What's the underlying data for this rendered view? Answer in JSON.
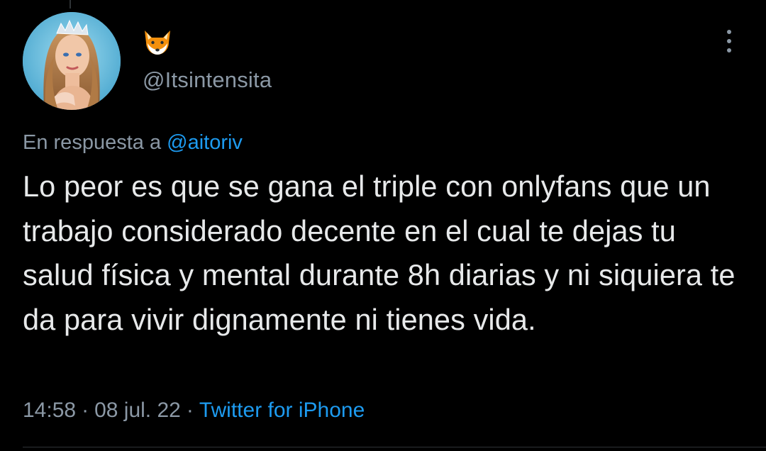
{
  "author": {
    "display_name_emoji": "fox-face-emoji",
    "handle": "@Itsintensita",
    "avatar": "profile-photo"
  },
  "reply": {
    "prefix": "En respuesta a",
    "mention": "@aitoriv"
  },
  "tweet": {
    "text": "Lo peor es que se gana el triple con onlyfans que un trabajo considerado decente en el cual te dejas tu salud física y mental durante 8h diarias y ni siquiera te da para vivir dignamente ni tienes vida."
  },
  "meta": {
    "time": "14:58",
    "separator": "·",
    "date": "08 jul. 22",
    "source": "Twitter for iPhone"
  },
  "icons": {
    "more": "more-vertical-icon"
  },
  "colors": {
    "background": "#000000",
    "text": "#e7e9ea",
    "secondary": "#8b98a5",
    "link": "#1d9bf0"
  }
}
